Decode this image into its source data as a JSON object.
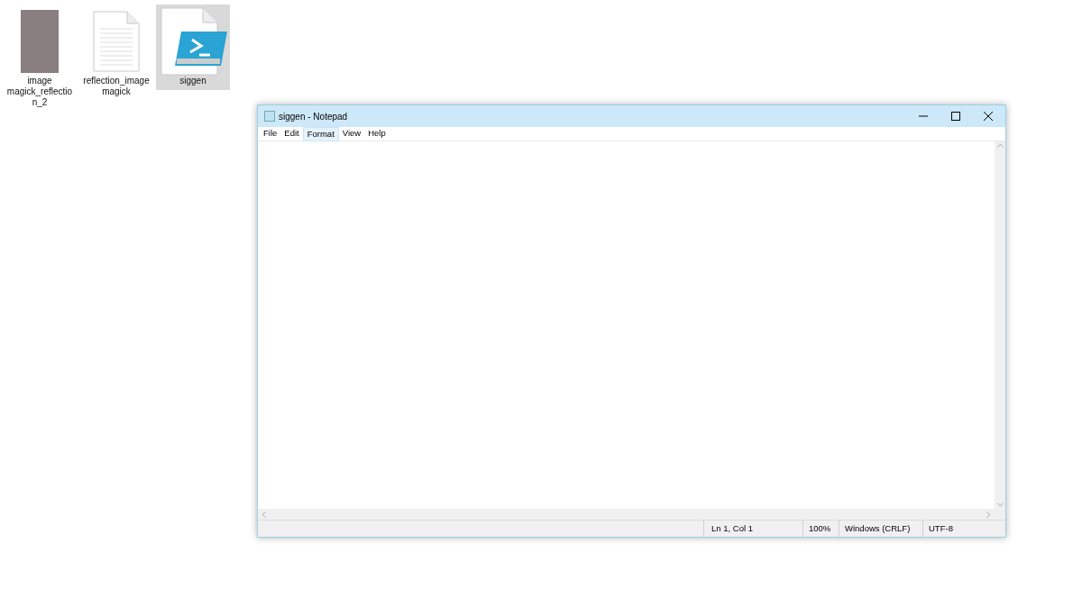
{
  "desktop_icons": [
    {
      "label": "image magick_reflectio n_2",
      "kind": "photo",
      "selected": false
    },
    {
      "label": "reflection_image magick",
      "kind": "document",
      "selected": false
    },
    {
      "label": "siggen",
      "kind": "script",
      "selected": true
    }
  ],
  "window": {
    "title": "siggen - Notepad"
  },
  "menu": [
    {
      "label": "File",
      "selected": false
    },
    {
      "label": "Edit",
      "selected": false
    },
    {
      "label": "Format",
      "selected": true
    },
    {
      "label": "View",
      "selected": false
    },
    {
      "label": "Help",
      "selected": false
    }
  ],
  "status_bar": {
    "position": "Ln 1, Col 1",
    "zoom": "100%",
    "line_endings": "Windows (CRLF)",
    "encoding": "UTF-8"
  }
}
